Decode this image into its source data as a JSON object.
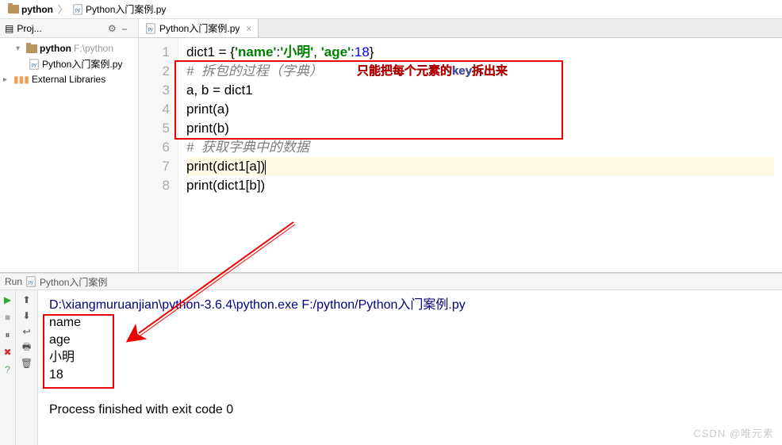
{
  "breadcrumb": {
    "project": "python",
    "file": "Python入门案例.py"
  },
  "project_panel": {
    "title": "Proj...",
    "root": "python",
    "root_hint": "F:\\python",
    "file": "Python入门案例.py",
    "libs": "External Libraries"
  },
  "tab": {
    "label": "Python入门案例.py"
  },
  "gutter": [
    "1",
    "2",
    "3",
    "4",
    "5",
    "6",
    "7",
    "8"
  ],
  "code": {
    "l1_a": "dict1 = {",
    "l1_s1": "'name'",
    "l1_c1": ":",
    "l1_s2": "'小明'",
    "l1_c2": ", ",
    "l1_s3": "'age'",
    "l1_c3": ":",
    "l1_n1": "18",
    "l1_e": "}",
    "l2": "#  拆包的过程（字典）",
    "l3": "a, b = dict1",
    "l4a": "print",
    "l4b": "(a)",
    "l5a": "print",
    "l5b": "(b)",
    "l6": "#  获取字典中的数据",
    "l7a": "print",
    "l7b": "(dict1[a])",
    "l8a": "print",
    "l8b": "(dict1[b])"
  },
  "annotation": {
    "pre": "只能把每个元素的",
    "key": "key",
    "post": "拆出来"
  },
  "run": {
    "title_prefix": "Run",
    "title": "Python入门案例",
    "cmd": "D:\\xiangmuruanjian\\python-3.6.4\\python.exe F:/python/Python入门案例.py",
    "out1": "name",
    "out2": "age",
    "out3": "小明",
    "out4": "18",
    "exit": "Process finished with exit code 0"
  },
  "watermark": "CSDN @唯元素"
}
